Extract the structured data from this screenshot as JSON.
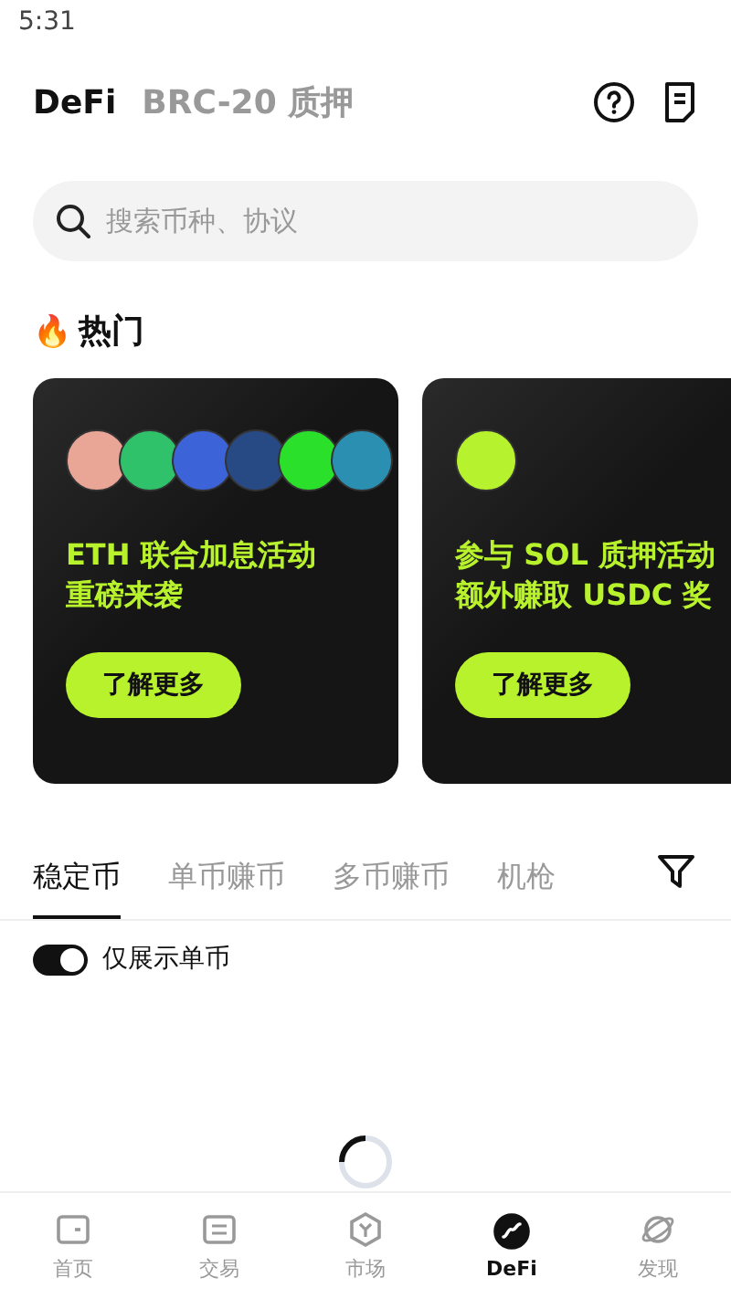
{
  "status_bar": {
    "time": "5:31"
  },
  "header": {
    "tabs": [
      {
        "label": "DeFi",
        "selected": true
      },
      {
        "label": "BRC-20 质押",
        "selected": false
      }
    ]
  },
  "search": {
    "placeholder": "搜索币种、协议"
  },
  "hot": {
    "icon": "🔥",
    "title": "热门"
  },
  "cards": [
    {
      "coins": [
        {
          "color": "#e9a596"
        },
        {
          "color": "#2fc26b"
        },
        {
          "color": "#3d63d8"
        },
        {
          "color": "#274a85"
        },
        {
          "color": "#2be02b"
        },
        {
          "color": "#2a8fb0"
        }
      ],
      "lines": [
        "ETH 联合加息活动",
        "重磅来袭"
      ],
      "button": "了解更多"
    },
    {
      "coins": [
        {
          "color": "#b6f22e"
        }
      ],
      "lines": [
        "参与 SOL 质押活动",
        "额外赚取 USDC 奖"
      ],
      "button": "了解更多"
    }
  ],
  "category_tabs": [
    {
      "label": "稳定币",
      "selected": true
    },
    {
      "label": "单币赚币",
      "selected": false
    },
    {
      "label": "多币赚币",
      "selected": false
    },
    {
      "label": "机枪",
      "selected": false
    }
  ],
  "toggle": {
    "label": "仅展示单币",
    "on": true
  },
  "bottom_nav": [
    {
      "label": "首页",
      "selected": false
    },
    {
      "label": "交易",
      "selected": false
    },
    {
      "label": "市场",
      "selected": false
    },
    {
      "label": "DeFi",
      "selected": true
    },
    {
      "label": "发现",
      "selected": false
    }
  ]
}
